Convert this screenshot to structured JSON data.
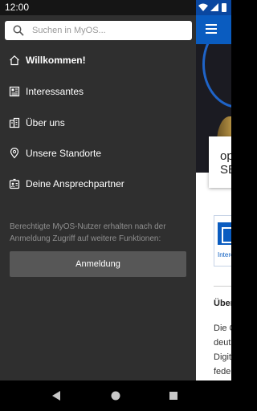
{
  "status_bar": {
    "time": "12:00"
  },
  "search": {
    "placeholder": "Suchen in MyOS..."
  },
  "menu": {
    "items": [
      {
        "label": "Willkommen!",
        "icon": "home-icon",
        "active": true
      },
      {
        "label": "Interessantes",
        "icon": "news-icon",
        "active": false
      },
      {
        "label": "Über uns",
        "icon": "building-icon",
        "active": false
      },
      {
        "label": "Unsere Standorte",
        "icon": "map-pin-icon",
        "active": false
      },
      {
        "label": "Deine Ansprechpartner",
        "icon": "contacts-icon",
        "active": false
      }
    ]
  },
  "login": {
    "hint": "Berechtigte MyOS-Nutzer erhalten nach der Anmeldung Zugriff auf weitere Funktionen:",
    "button_label": "Anmeldung"
  },
  "background": {
    "card_lines": [
      "op",
      "SE"
    ],
    "tile_label": "Intere",
    "section_title": "Über",
    "text_lines": [
      "Die O",
      "deuts",
      "Digit",
      "feder"
    ]
  },
  "colors": {
    "drawer_bg": "#2f2f2f",
    "status_bar": "#151515",
    "brand_blue": "#0a5cc0",
    "button_bg": "#575757",
    "hint_text": "#8f8f8f"
  }
}
